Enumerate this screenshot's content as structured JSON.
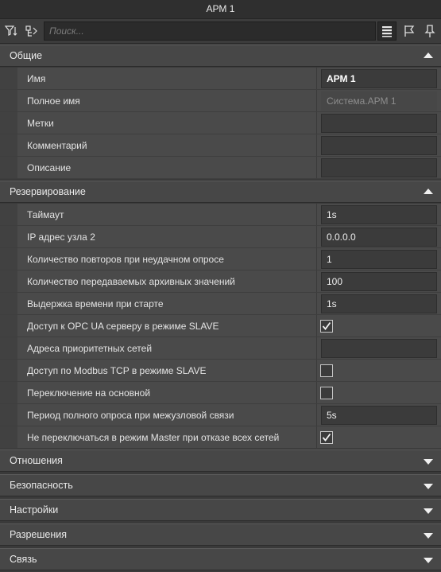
{
  "window": {
    "title": "АРМ 1"
  },
  "toolbar": {
    "search_placeholder": "Поиск..."
  },
  "sections": {
    "general": {
      "title": "Общие",
      "rows": [
        {
          "label": "Имя",
          "value": "АРМ 1"
        },
        {
          "label": "Полное имя",
          "value": "Система.АРМ 1"
        },
        {
          "label": "Метки",
          "value": ""
        },
        {
          "label": "Комментарий",
          "value": ""
        },
        {
          "label": "Описание",
          "value": ""
        }
      ]
    },
    "redundancy": {
      "title": "Резервирование",
      "rows": [
        {
          "label": "Таймаут",
          "value": "1s"
        },
        {
          "label": "IP адрес узла 2",
          "value": "0.0.0.0"
        },
        {
          "label": "Количество повторов при неудачном опросе",
          "value": "1"
        },
        {
          "label": "Количество передаваемых архивных значений",
          "value": "100"
        },
        {
          "label": "Выдержка времени при старте",
          "value": "1s"
        },
        {
          "label": "Доступ к OPC UA серверу в режиме SLAVE",
          "checked": true
        },
        {
          "label": "Адреса приоритетных сетей",
          "value": ""
        },
        {
          "label": "Доступ по Modbus TCP в режиме SLAVE",
          "checked": false
        },
        {
          "label": "Переключение на основной",
          "checked": false
        },
        {
          "label": "Период полного опроса при межузловой связи",
          "value": "5s"
        },
        {
          "label": "Не переключаться в режим Master при отказе всех сетей",
          "checked": true
        }
      ]
    },
    "relations": {
      "title": "Отношения"
    },
    "security": {
      "title": "Безопасность"
    },
    "settings": {
      "title": "Настройки"
    },
    "permissions": {
      "title": "Разрешения"
    },
    "link": {
      "title": "Связь"
    }
  }
}
